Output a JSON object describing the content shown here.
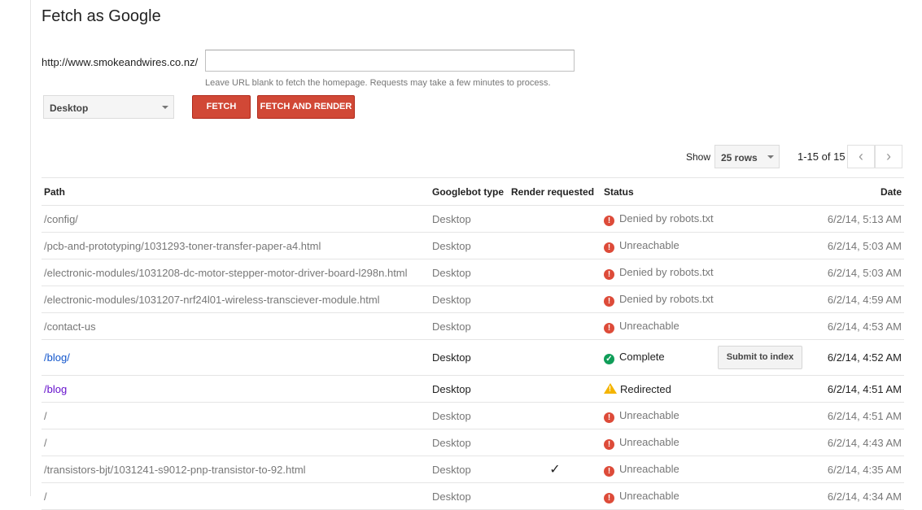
{
  "page": {
    "title": "Fetch as Google"
  },
  "fetch_form": {
    "url_prefix": "http://www.smokeandwires.co.nz/",
    "url_value": "",
    "hint": "Leave URL blank to fetch the homepage. Requests may take a few minutes to process.",
    "device_selected": "Desktop",
    "fetch_label": "FETCH",
    "fetch_render_label": "FETCH AND RENDER"
  },
  "pagination": {
    "show_label": "Show",
    "rows_selected": "25 rows",
    "range": "1-15 of 15"
  },
  "table": {
    "headers": {
      "path": "Path",
      "googlebot": "Googlebot type",
      "render": "Render requested",
      "status": "Status",
      "date": "Date"
    },
    "submit_label": "Submit to index",
    "rows": [
      {
        "path": "/config/",
        "googlebot": "Desktop",
        "render": "",
        "status": "Denied by robots.txt",
        "status_type": "error",
        "date": "6/2/14, 5:13 AM"
      },
      {
        "path": "/pcb-and-prototyping/1031293-toner-transfer-paper-a4.html",
        "googlebot": "Desktop",
        "render": "",
        "status": "Unreachable",
        "status_type": "error",
        "date": "6/2/14, 5:03 AM"
      },
      {
        "path": "/electronic-modules/1031208-dc-motor-stepper-motor-driver-board-l298n.html",
        "googlebot": "Desktop",
        "render": "",
        "status": "Denied by robots.txt",
        "status_type": "error",
        "date": "6/2/14, 5:03 AM"
      },
      {
        "path": "/electronic-modules/1031207-nrf24l01-wireless-transciever-module.html",
        "googlebot": "Desktop",
        "render": "",
        "status": "Denied by robots.txt",
        "status_type": "error",
        "date": "6/2/14, 4:59 AM"
      },
      {
        "path": "/contact-us",
        "googlebot": "Desktop",
        "render": "",
        "status": "Unreachable",
        "status_type": "error",
        "date": "6/2/14, 4:53 AM"
      },
      {
        "path": "/blog/",
        "googlebot": "Desktop",
        "render": "",
        "status": "Complete",
        "status_type": "complete",
        "date": "6/2/14, 4:52 AM"
      },
      {
        "path": "/blog",
        "googlebot": "Desktop",
        "render": "",
        "status": "Redirected",
        "status_type": "warning",
        "date": "6/2/14, 4:51 AM"
      },
      {
        "path": "/",
        "googlebot": "Desktop",
        "render": "",
        "status": "Unreachable",
        "status_type": "error",
        "date": "6/2/14, 4:51 AM"
      },
      {
        "path": "/",
        "googlebot": "Desktop",
        "render": "",
        "status": "Unreachable",
        "status_type": "error",
        "date": "6/2/14, 4:43 AM"
      },
      {
        "path": "/transistors-bjt/1031241-s9012-pnp-transistor-to-92.html",
        "googlebot": "Desktop",
        "render": "✓",
        "status": "Unreachable",
        "status_type": "error",
        "date": "6/2/14, 4:35 AM"
      },
      {
        "path": "/",
        "googlebot": "Desktop",
        "render": "",
        "status": "Unreachable",
        "status_type": "error",
        "date": "6/2/14, 4:34 AM"
      }
    ]
  },
  "colors": {
    "accent_red": "#d14836",
    "error": "#dd4b39",
    "success": "#0f9d58",
    "warning": "#f4b400",
    "link": "#15c",
    "visited": "#61c"
  }
}
